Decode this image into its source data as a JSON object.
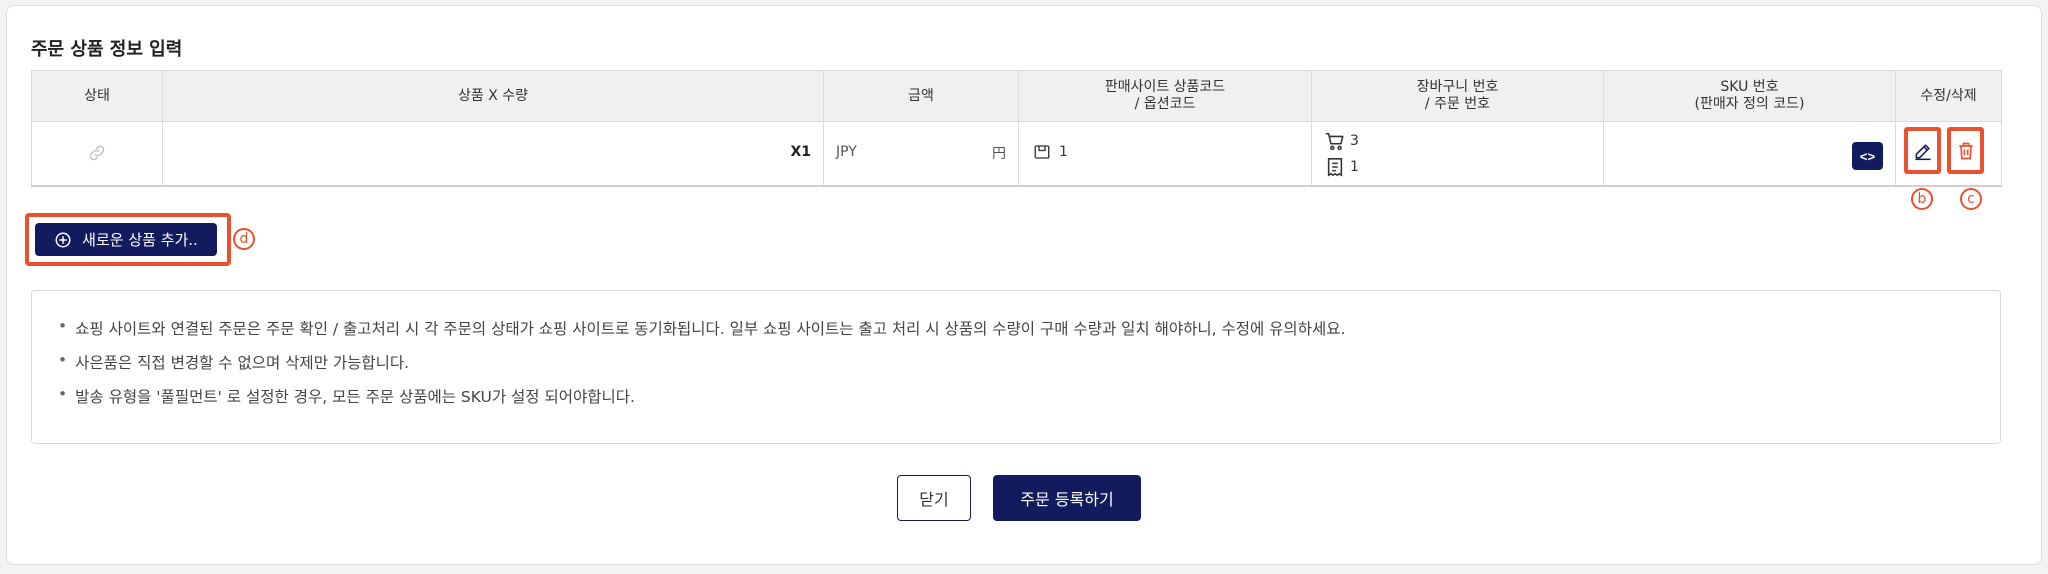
{
  "section": {
    "title": "주문 상품 정보 입력"
  },
  "table": {
    "headers": {
      "status": "상태",
      "product_qty": "상품 X 수량",
      "amount": "금액",
      "site_code_line1": "판매사이트 상품코드",
      "site_code_line2": "/ 옵션코드",
      "cart_line1": "장바구니 번호",
      "cart_line2": "/ 주문 번호",
      "sku_line1": "SKU 번호",
      "sku_line2": "(판매자 정의 코드)",
      "actions": "수정/삭제"
    },
    "rows": [
      {
        "quantity": "X1",
        "currency_code": "JPY",
        "currency_symbol": "円",
        "site_code": "1",
        "cart_no": "3",
        "order_no": "1",
        "sku_button": "<>"
      }
    ]
  },
  "markers": {
    "edit": "b",
    "delete": "c",
    "add": "d"
  },
  "add_button": {
    "label": "새로운 상품 추가.."
  },
  "notices": [
    "쇼핑 사이트와 연결된 주문은 주문 확인 / 출고처리 시 각 주문의 상태가 쇼핑 사이트로 동기화됩니다. 일부 쇼핑 사이트는 출고 처리 시 상품의 수량이 구매 수량과 일치 해야하니, 수정에 유의하세요.",
    "사은품은 직접 변경할 수 없으며 삭제만 가능합니다.",
    "발송 유형을 '풀필먼트' 로 설정한 경우, 모든 주문 상품에는 SKU가 설정 되어야합니다."
  ],
  "footer": {
    "close_label": "닫기",
    "submit_label": "주문 등록하기"
  },
  "colors": {
    "primary": "#111b5e",
    "highlight": "#e8522f"
  },
  "icons": [
    "link-icon",
    "barcode-icon",
    "cart-icon",
    "receipt-icon",
    "code-icon",
    "pencil-icon",
    "trash-icon",
    "plus-circle-icon"
  ]
}
